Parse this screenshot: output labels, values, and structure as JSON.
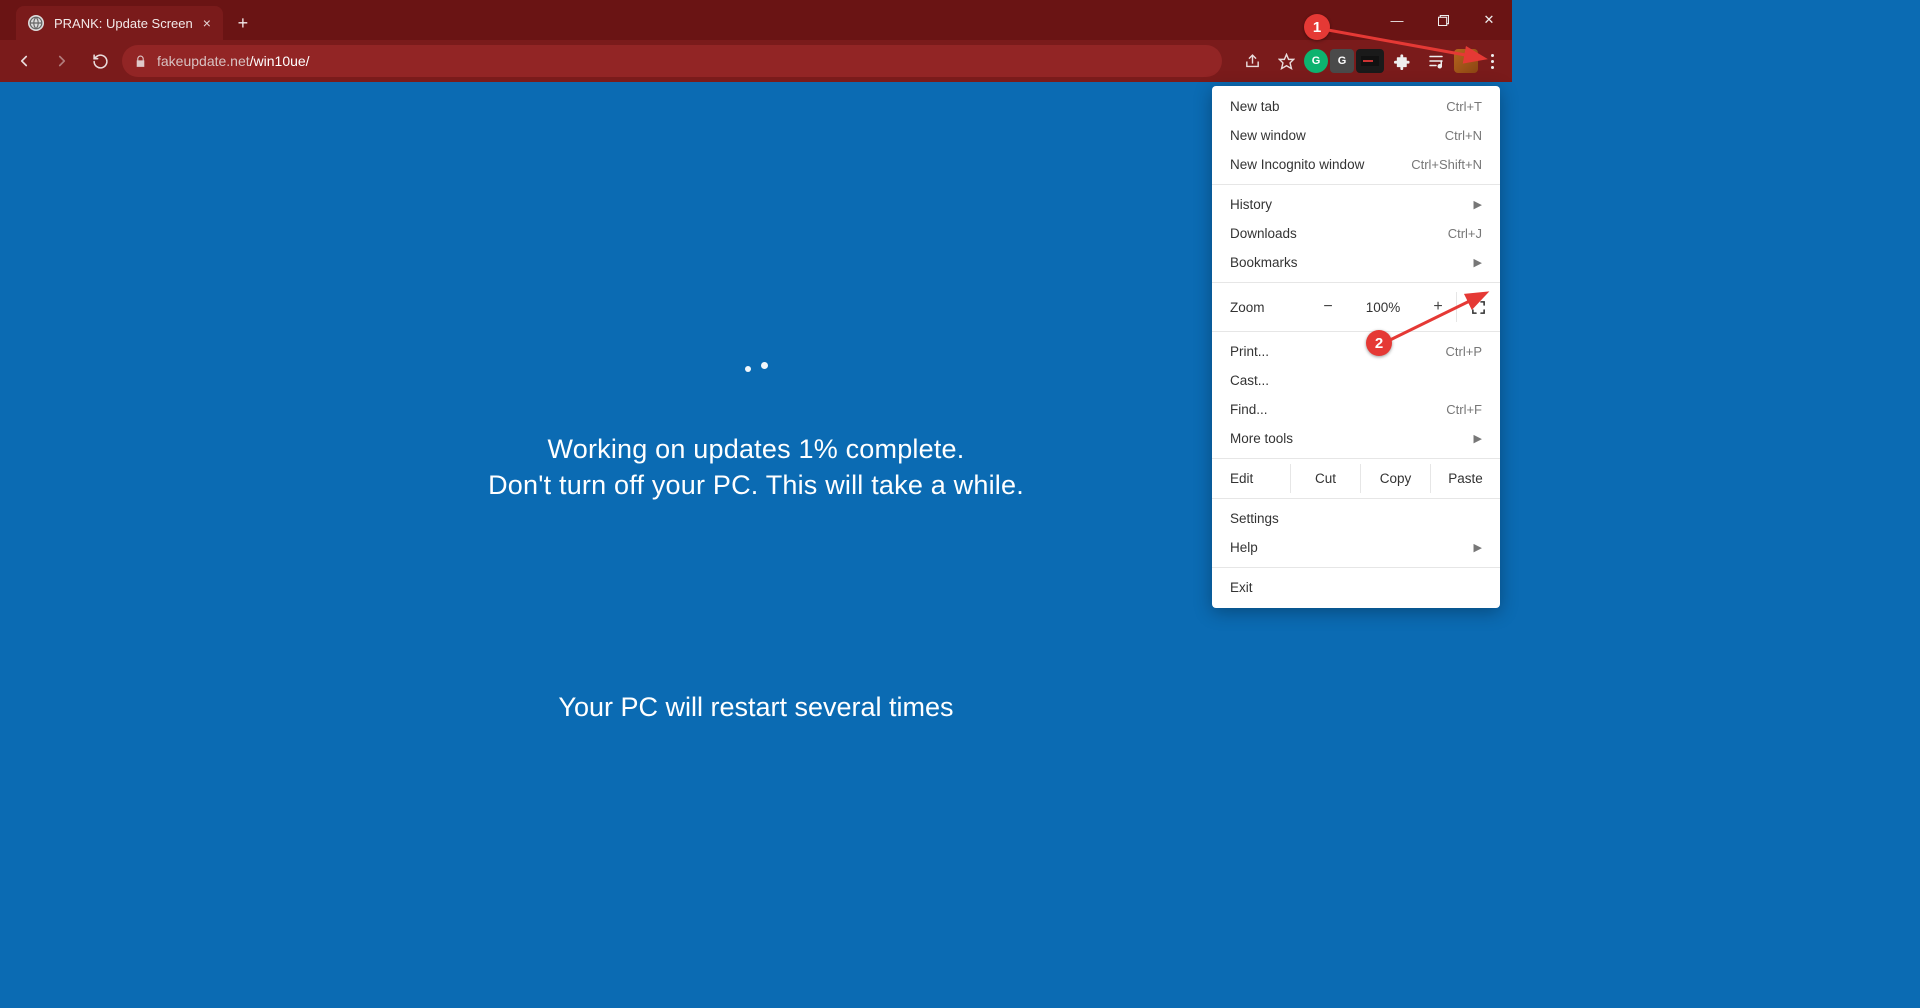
{
  "browser": {
    "tab_title": "PRANK: Update Screen",
    "url_host": "fakeupdate.net",
    "url_path": "/win10ue/",
    "window_controls": {
      "minimize": "—",
      "maximize": "▢",
      "close": "✕"
    },
    "extensions": {
      "grammarly": "G",
      "google": "G"
    }
  },
  "menu": {
    "new_tab": {
      "label": "New tab",
      "shortcut": "Ctrl+T"
    },
    "new_window": {
      "label": "New window",
      "shortcut": "Ctrl+N"
    },
    "new_incognito": {
      "label": "New Incognito window",
      "shortcut": "Ctrl+Shift+N"
    },
    "history": {
      "label": "History"
    },
    "downloads": {
      "label": "Downloads",
      "shortcut": "Ctrl+J"
    },
    "bookmarks": {
      "label": "Bookmarks"
    },
    "zoom": {
      "label": "Zoom",
      "minus": "−",
      "value": "100%",
      "plus": "+"
    },
    "print": {
      "label": "Print...",
      "shortcut": "Ctrl+P"
    },
    "cast": {
      "label": "Cast..."
    },
    "find": {
      "label": "Find...",
      "shortcut": "Ctrl+F"
    },
    "more_tools": {
      "label": "More tools"
    },
    "edit": {
      "label": "Edit",
      "cut": "Cut",
      "copy": "Copy",
      "paste": "Paste"
    },
    "settings": {
      "label": "Settings"
    },
    "help": {
      "label": "Help"
    },
    "exit": {
      "label": "Exit"
    }
  },
  "page": {
    "line1": "Working on updates  1% complete.",
    "line2": "Don't turn off your PC. This will take a while.",
    "restart": "Your PC will restart several times"
  },
  "annotations": {
    "callout1": "1",
    "callout2": "2"
  }
}
